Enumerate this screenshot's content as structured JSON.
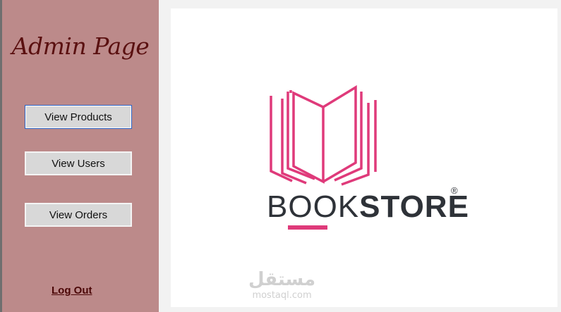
{
  "sidebar": {
    "title": "Admin Page",
    "buttons": {
      "view_products": "View Products",
      "view_users": "View Users",
      "view_orders": "View Orders"
    },
    "logout": "Log Out"
  },
  "logo": {
    "brand_light": "BOOK",
    "brand_bold": "STORE",
    "registered": "®",
    "icon": "open-book-icon"
  },
  "watermark": {
    "arabic": "مستقل",
    "url": "mostaql.com"
  },
  "colors": {
    "sidebar_bg": "#bc8a8a",
    "title_color": "#5a1010",
    "logo_accent": "#df3a7a",
    "logo_text": "#2e3238"
  }
}
